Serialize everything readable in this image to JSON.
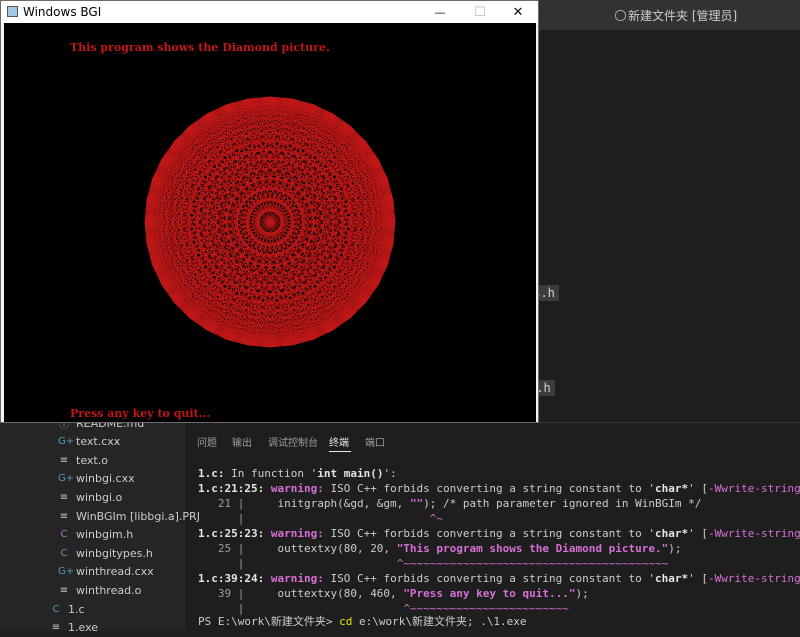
{
  "vscode": {
    "title": "新建文件夹 [管理员]",
    "editor_chips": [
      "es.h",
      "s.h"
    ]
  },
  "panel": {
    "tabs": [
      "问题",
      "输出",
      "调试控制台",
      "终端",
      "端口"
    ],
    "active_tab": "终端"
  },
  "explorer": {
    "items": [
      {
        "name": "README.md",
        "icon": "info-icon",
        "glyph": "ⓘ",
        "color": "#519aba"
      },
      {
        "name": "text.cxx",
        "icon": "cpp-icon",
        "glyph": "G+",
        "color": "#519aba"
      },
      {
        "name": "text.o",
        "icon": "lines-icon",
        "glyph": "≡",
        "color": "#cccccc"
      },
      {
        "name": "winbgi.cxx",
        "icon": "cpp-icon",
        "glyph": "G+",
        "color": "#519aba"
      },
      {
        "name": "winbgi.o",
        "icon": "lines-icon",
        "glyph": "≡",
        "color": "#cccccc"
      },
      {
        "name": "WinBGIm [libbgi.a].PRJ",
        "icon": "lines-icon",
        "glyph": "≡",
        "color": "#cccccc"
      },
      {
        "name": "winbgim.h",
        "icon": "c-header-icon",
        "glyph": "C",
        "color": "#a074c4"
      },
      {
        "name": "winbgitypes.h",
        "icon": "c-header-icon",
        "glyph": "C",
        "color": "#a074c4"
      },
      {
        "name": "winthread.cxx",
        "icon": "cpp-icon",
        "glyph": "G+",
        "color": "#519aba"
      },
      {
        "name": "winthread.o",
        "icon": "lines-icon",
        "glyph": "≡",
        "color": "#cccccc"
      },
      {
        "name": "1.c",
        "icon": "c-file-icon",
        "glyph": "C",
        "color": "#519aba"
      },
      {
        "name": "1.exe",
        "icon": "lines-icon",
        "glyph": "≡",
        "color": "#cccccc"
      }
    ]
  },
  "terminal": {
    "l1": {
      "file": "1.c:",
      "msg": " In function '",
      "fn": "int main()",
      "end": "':"
    },
    "w1": {
      "loc": "1.c:21:25:",
      "label": " warning:",
      "msg": " ISO C++ forbids converting a string constant to '",
      "type": "char*",
      "mid": "' [",
      "flag": "-Wwrite-strings",
      "end": "]"
    },
    "c1": {
      "ln": "   21 |",
      "pre": "     initgraph(&gd, &gm, ",
      "str": "\"\"",
      "post": "); /* path parameter ignored in WinBGIm */"
    },
    "u1": {
      "bar": "      |",
      "pad": "                            ",
      "marks": "^~"
    },
    "w2": {
      "loc": "1.c:25:23:",
      "label": " warning:",
      "msg": " ISO C++ forbids converting a string constant to '",
      "type": "char*",
      "mid": "' [",
      "flag": "-Wwrite-strings",
      "end": "]"
    },
    "c2": {
      "ln": "   25 |",
      "pre": "     outtextxy(80, 20, ",
      "str": "\"This program shows the Diamond picture.\"",
      "post": ");"
    },
    "u2": {
      "bar": "      |",
      "pad": "                       ",
      "marks": "^~~~~~~~~~~~~~~~~~~~~~~~~~~~~~~~~~~~~~~~~"
    },
    "w3": {
      "loc": "1.c:39:24:",
      "label": " warning:",
      "msg": " ISO C++ forbids converting a string constant to '",
      "type": "char*",
      "mid": "' [",
      "flag": "-Wwrite-strings",
      "end": "]"
    },
    "c3": {
      "ln": "   39 |",
      "pre": "     outtextxy(80, 460, ",
      "str": "\"Press any key to quit...\"",
      "post": ");"
    },
    "u3": {
      "bar": "      |",
      "pad": "                        ",
      "marks": "^~~~~~~~~~~~~~~~~~~~~~~~~"
    },
    "prompt": {
      "ps": "PS E:\\work\\新建文件夹> ",
      "cmd": "cd",
      "args": " e:\\work\\新建文件夹; .\\1.exe"
    }
  },
  "bgi": {
    "title": "Windows BGI",
    "minimize": "—",
    "maximize": "☐",
    "close": "✕",
    "canvas_color": "#000000",
    "line_color": "#c01818",
    "top_text": "This program shows the Diamond picture.",
    "bottom_text": "Press any key to quit...",
    "diamond_vertices": 36
  }
}
